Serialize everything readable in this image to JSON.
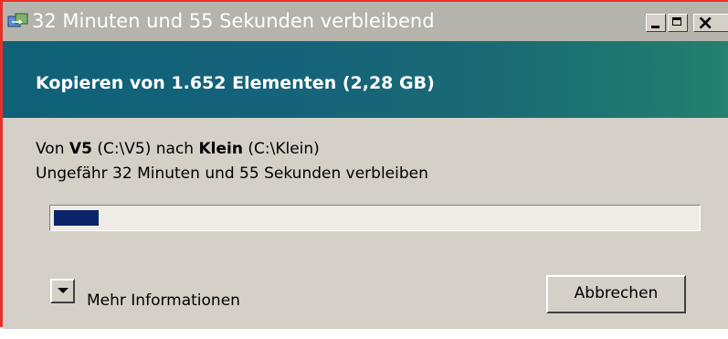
{
  "window": {
    "title": "32 Minuten und 55 Sekunden verbleibend",
    "caption_buttons": {
      "minimize": "minimize-icon",
      "maximize": "maximize-icon",
      "close": "close-icon"
    }
  },
  "header": {
    "title": "Kopieren von 1.652 Elementen (2,28 GB)"
  },
  "details": {
    "from_prefix": "Von",
    "source_name": "V5",
    "source_path": "(C:\\V5)",
    "to_word": "nach",
    "dest_name": "Klein",
    "dest_path": "(C:\\Klein)",
    "remaining": "Ungefähr 32 Minuten und 55 Sekunden verbleiben"
  },
  "progress": {
    "fraction": 0.07
  },
  "footer": {
    "more_info_label": "Mehr Informationen",
    "cancel_label": "Abbrechen"
  },
  "colors": {
    "border_accent": "#e8302a",
    "banner": "#0f6178",
    "progress_fill": "#0a246a"
  }
}
